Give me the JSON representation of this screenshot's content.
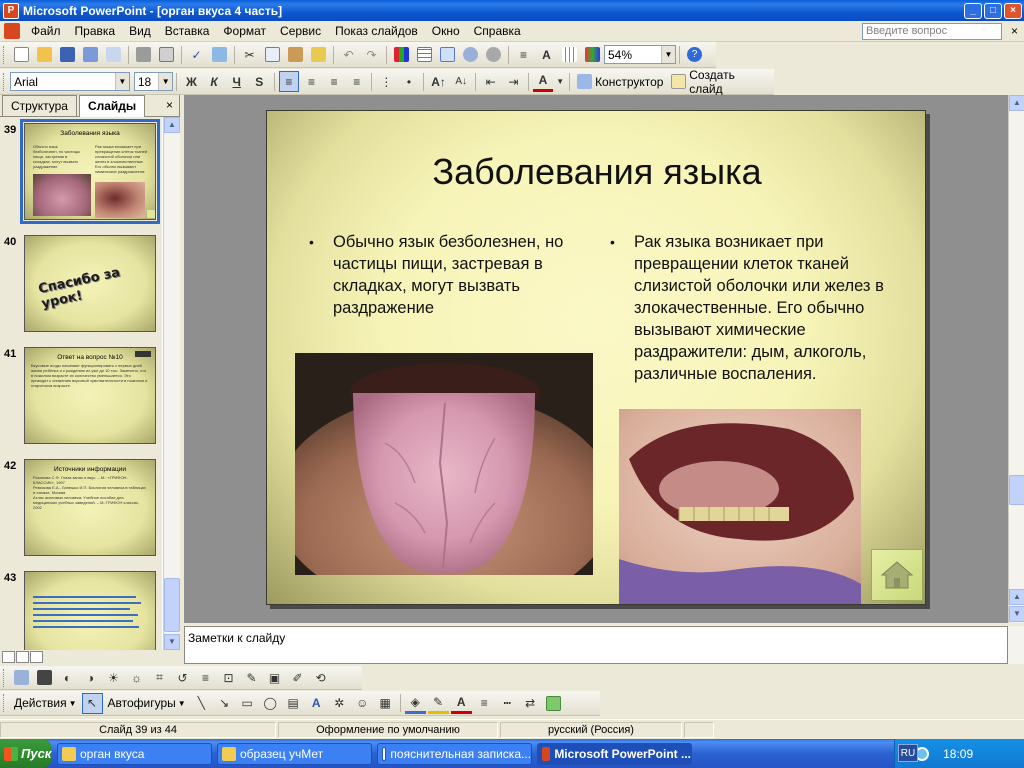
{
  "titlebar": {
    "title": "Microsoft PowerPoint - [орган вкуса 4 часть]",
    "min": "_",
    "max": "□",
    "close": "×"
  },
  "menubar": {
    "items": [
      "Файл",
      "Правка",
      "Вид",
      "Вставка",
      "Формат",
      "Сервис",
      "Показ слайдов",
      "Окно",
      "Справка"
    ],
    "help_placeholder": "Введите вопрос",
    "close": "×"
  },
  "toolbar_standard": {
    "zoom": "54%"
  },
  "toolbar_formatting": {
    "font": "Arial",
    "size": "18",
    "bold": "Ж",
    "italic": "К",
    "underline": "Ч",
    "shadow": "S",
    "designer": "Конструктор",
    "new_slide": "Создать слайд"
  },
  "left_panel": {
    "tabs": [
      "Структура",
      "Слайды"
    ],
    "close": "×",
    "thumbnails": [
      {
        "num": "39",
        "title": "Заболевания языка",
        "selected": true
      },
      {
        "num": "40",
        "text": "Спасибо за урок!"
      },
      {
        "num": "41",
        "title": "Ответ на вопрос №10",
        "body": "Вкусовые ягоды начинают функционировать с первых дней жизни ребёнка и к рождению их уже до 10 тыс. Замечено, что в пожилом возрасте их количество уменьшается. Это приводит к снижению вкусовой чувствительности в пожилом и старческом возрасте."
      },
      {
        "num": "42",
        "title": "Источники информации",
        "body": [
          "Розанова С.Ф. Глаза запах и вкус. – М.: «ГРИФОН-КЛАССИК», 1997",
          "Ремизова Е.А., Лапешко И.П. Биология человека в таблицах и схемах. Москва",
          "Атлас анатомии человека: Учебное пособие для медицинских учебных заведений. – М.:ГРИФОН классик, 2002"
        ]
      },
      {
        "num": "43"
      }
    ]
  },
  "slide": {
    "title": "Заболевания языка",
    "left_text": "Обычно язык безболезнен, но частицы пищи, застревая в складках, могут вызвать раздражение",
    "right_text": "Рак языка возникает при превращении клеток тканей слизистой оболочки или желез в злокачественные. Его обычно вызывают химические раздражители: дым, алкоголь, различные воспаления.",
    "bullet": "•"
  },
  "notes": {
    "placeholder": "Заметки к слайду"
  },
  "drawing_toolbar": {
    "actions": "Действия",
    "autoshapes": "Автофигуры"
  },
  "statusbar": {
    "slide": "Слайд 39 из 44",
    "design": "Оформление по умолчанию",
    "language": "русский (Россия)"
  },
  "taskbar": {
    "start": "Пуск",
    "tasks": [
      {
        "label": "орган вкуса",
        "active": false
      },
      {
        "label": "образец учМет",
        "active": false
      },
      {
        "label": "пояснительная записка...",
        "active": false
      },
      {
        "label": "Microsoft PowerPoint ...",
        "active": true
      }
    ],
    "lang": "RU",
    "time": "18:09"
  },
  "colors": {
    "slide_bg": "#F7F4B8",
    "title_bar": "#0A5FD8",
    "selection": "#316AC5"
  }
}
